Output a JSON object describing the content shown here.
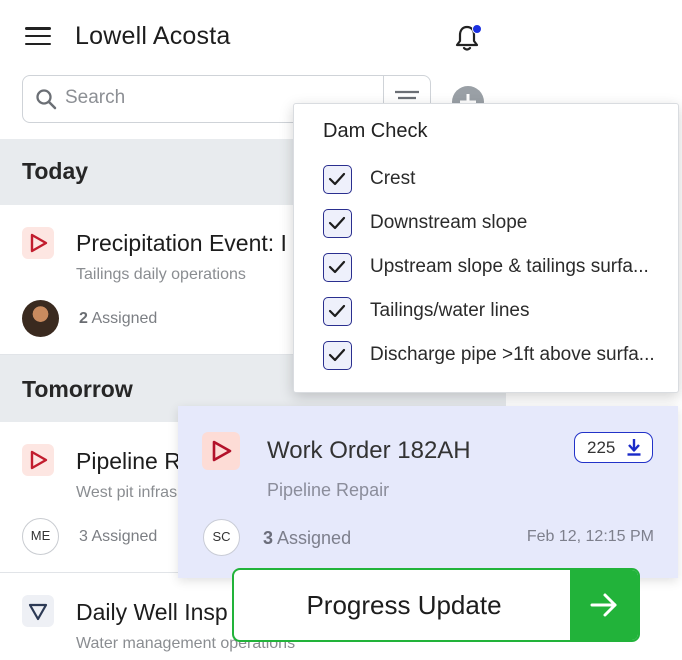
{
  "header": {
    "title": "Lowell Acosta",
    "notification_dot_color": "#1a2fe0"
  },
  "search": {
    "placeholder": "Search"
  },
  "sections": {
    "today_label": "Today",
    "tomorrow_label": "Tomorrow"
  },
  "items": [
    {
      "title": "Precipitation Event: I",
      "subtitle": "Tailings daily operations",
      "assigned_count": "2",
      "assigned_label": "Assigned",
      "icon": "play-triangle-icon"
    },
    {
      "title": "Pipeline R",
      "subtitle": "West pit infras",
      "avatar_initials": "ME",
      "assigned_count": "3",
      "assigned_label": "Assigned",
      "icon": "play-triangle-icon"
    },
    {
      "title": "Daily Well Insp",
      "subtitle": "Water management operations",
      "icon": "down-triangle-icon"
    }
  ],
  "dropdown": {
    "title": "Dam Check",
    "options": [
      {
        "label": "Crest",
        "checked": true
      },
      {
        "label": "Downstream slope",
        "checked": true
      },
      {
        "label": "Upstream slope & tailings surfa...",
        "checked": true
      },
      {
        "label": "Tailings/water lines",
        "checked": true
      },
      {
        "label": "Discharge pipe >1ft above surfa...",
        "checked": true
      }
    ]
  },
  "work_order": {
    "title": "Work Order 182AH",
    "subtitle": "Pipeline Repair",
    "badge_count": "225",
    "avatar_initials": "SC",
    "assigned_count": "3",
    "assigned_label": "Assigned",
    "date": "Feb 12, 12:15 PM"
  },
  "progress_button": {
    "label": "Progress Update",
    "color": "#22b33a"
  }
}
